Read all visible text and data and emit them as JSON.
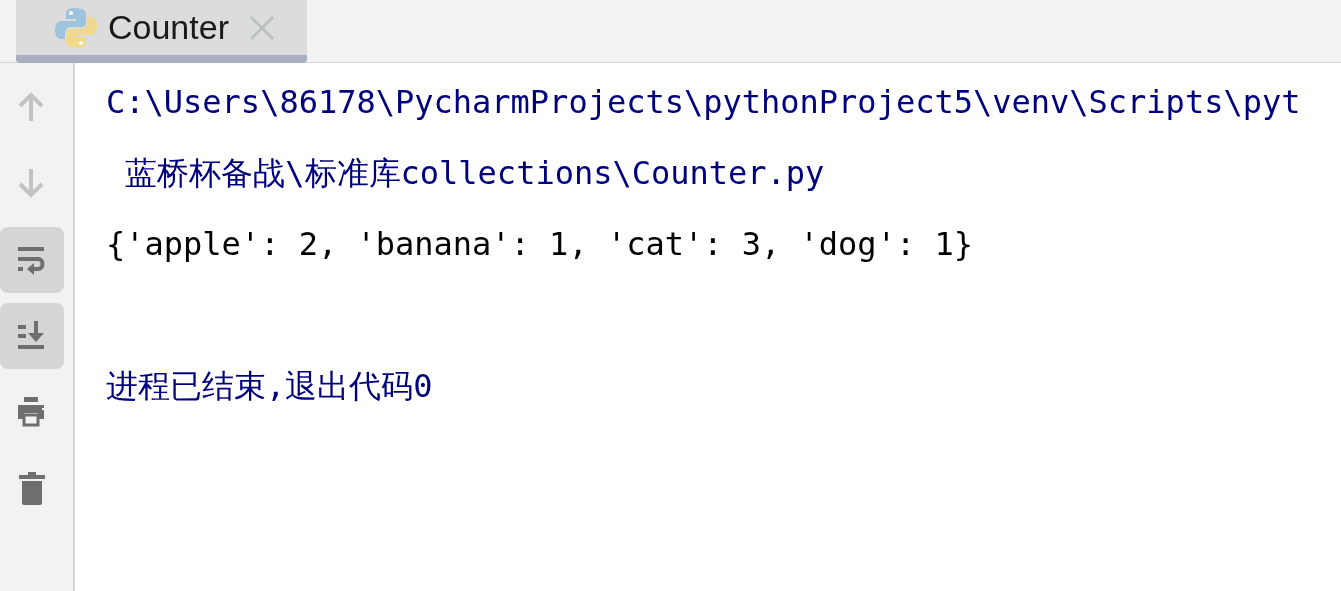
{
  "tabs": [
    {
      "label": "Counter",
      "selected": true
    }
  ],
  "toolbar": [
    {
      "kind": "up",
      "disabled": true,
      "on": false
    },
    {
      "kind": "down",
      "disabled": true,
      "on": false
    },
    {
      "kind": "wrap",
      "disabled": false,
      "on": true
    },
    {
      "kind": "scroll",
      "disabled": false,
      "on": true
    },
    {
      "kind": "print",
      "disabled": false,
      "on": false
    },
    {
      "kind": "trash",
      "disabled": false,
      "on": false
    }
  ],
  "console": [
    {
      "kind": "system",
      "text": "C:\\Users\\86178\\PycharmProjects\\pythonProject5\\venv\\Scripts\\pyt"
    },
    {
      "kind": "system",
      "text": " 蓝桥杯备战\\标准库collections\\Counter.py"
    },
    {
      "kind": "output",
      "text": "{'apple': 2, 'banana': 1, 'cat': 3, 'dog': 1}"
    },
    {
      "kind": "blank"
    },
    {
      "kind": "system",
      "text": "进程已结束,退出代码0"
    }
  ]
}
